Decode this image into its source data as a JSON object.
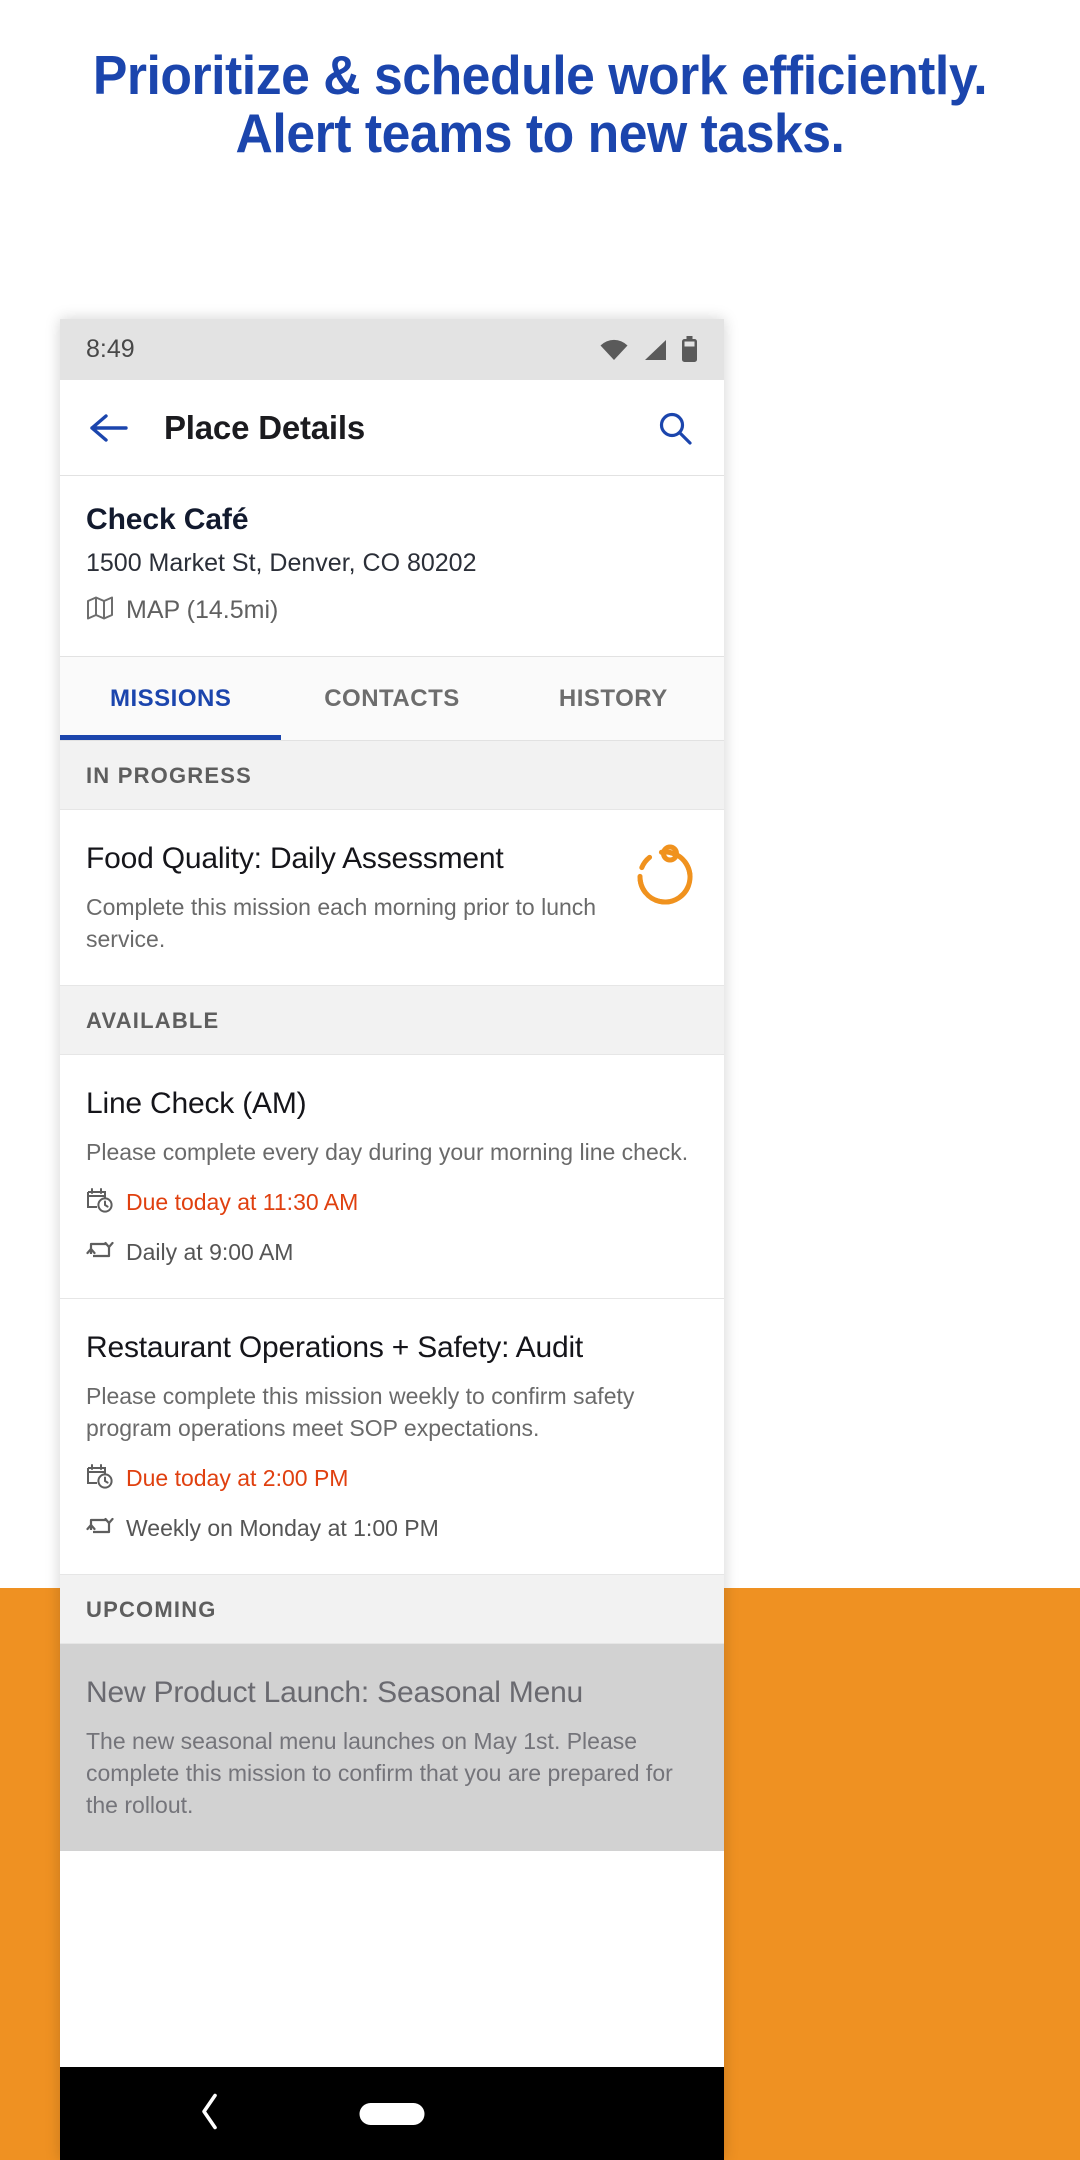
{
  "promo": {
    "headline_line1": "Prioritize & schedule work efficiently.",
    "headline_line2": "Alert teams to new tasks.",
    "headline_color": "#1b45ad",
    "band_color": "#ef9122"
  },
  "statusbar": {
    "time": "8:49",
    "icons": [
      "wifi-icon",
      "cell-signal-icon",
      "battery-icon"
    ]
  },
  "appbar": {
    "back_label": "back-arrow",
    "title": "Place Details",
    "search_label": "search",
    "accent_color": "#1b45ad"
  },
  "place": {
    "name": "Check Café",
    "address": "1500 Market St, Denver, CO 80202",
    "map_label": "MAP (14.5mi)"
  },
  "tabs": [
    {
      "label": "MISSIONS",
      "active": true
    },
    {
      "label": "CONTACTS",
      "active": false
    },
    {
      "label": "HISTORY",
      "active": false
    }
  ],
  "sections": [
    {
      "header": "IN PROGRESS",
      "missions": [
        {
          "title": "Food Quality: Daily Assessment",
          "description": "Complete this mission each morning prior to lunch service.",
          "progress": true,
          "progress_color": "#f0921e",
          "due": null,
          "repeat": null,
          "dimmed": false
        }
      ]
    },
    {
      "header": "AVAILABLE",
      "missions": [
        {
          "title": "Line Check (AM)",
          "description": "Please complete every day during your morning line check.",
          "progress": false,
          "due": "Due today at 11:30 AM",
          "repeat": "Daily at 9:00 AM",
          "dimmed": false
        },
        {
          "title": "Restaurant Operations + Safety: Audit",
          "description": "Please complete this mission weekly to confirm safety program operations meet SOP expectations.",
          "progress": false,
          "due": "Due today at 2:00 PM",
          "repeat": "Weekly on Monday at 1:00 PM",
          "dimmed": false
        }
      ]
    },
    {
      "header": "UPCOMING",
      "missions": [
        {
          "title": "New Product Launch: Seasonal Menu",
          "description": "The new seasonal menu launches on May 1st. Please complete this mission to confirm that you are prepared for the rollout.",
          "progress": false,
          "due": null,
          "repeat": null,
          "dimmed": true
        }
      ]
    }
  ],
  "navbar": {
    "back_label": "nav-back",
    "home_label": "nav-home-pill"
  },
  "colors": {
    "due_red": "#e0400f",
    "progress_orange": "#f0921e",
    "accent_blue": "#1b45ad"
  }
}
